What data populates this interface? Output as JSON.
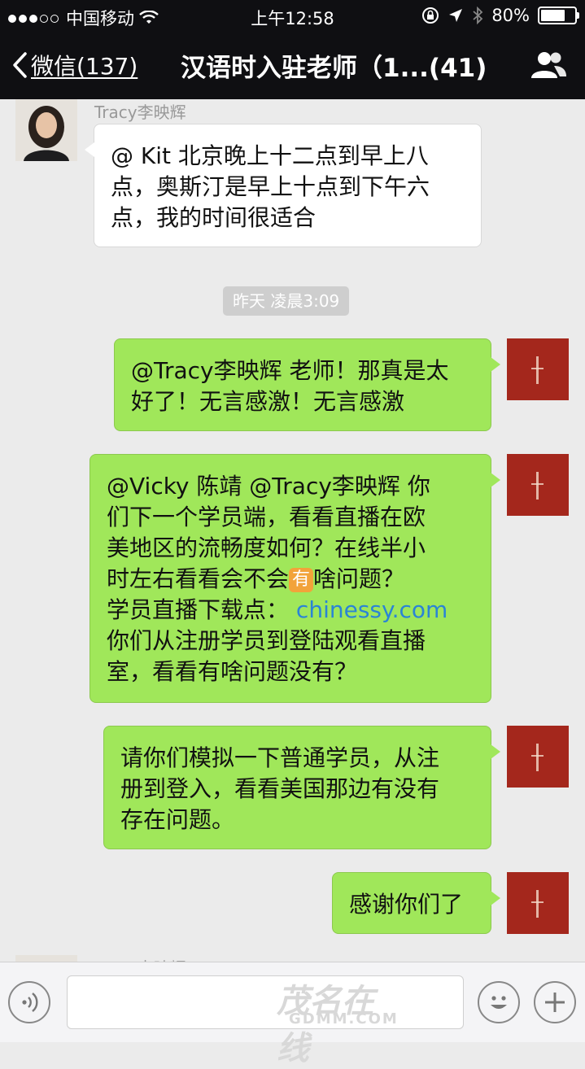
{
  "status_bar": {
    "carrier": "中国移动",
    "time": "上午12:58",
    "battery": "80%",
    "battery_level": 0.8
  },
  "nav": {
    "back_label": "微信(137)",
    "title": "汉语时入驻老师（1...(41)"
  },
  "messages": [
    {
      "sender": "Tracy李映辉",
      "direction": "in",
      "lines": [
        "@ Kit 北京晚上十二点到早上八",
        "点，奥斯汀是早上十点到下午六",
        "点，我的时间很适合"
      ]
    },
    {
      "direction": "out",
      "lines": [
        "@Tracy李映辉 老师！那真是太",
        "好了！无言感激！无言感激"
      ]
    },
    {
      "direction": "out",
      "lines_before": [
        "@Vicky 陈靖 @Tracy李映辉 你",
        "们下一个学员端，看看直播在欧",
        "美地区的流畅度如何？在线半小"
      ],
      "line4_start": "时左右看看会不会",
      "emoji": "有",
      "line4_end": "啥问题？",
      "line5_start": "学员直播下载点：",
      "link": "chinessy.com",
      "lines_after": [
        "你们从注册学员到登陆观看直播",
        "室，看看有啥问题没有？"
      ]
    },
    {
      "direction": "out",
      "lines": [
        "请你们模拟一下普通学员，从注",
        "册到登入，看看美国那边有没有",
        "存在问题。"
      ]
    },
    {
      "direction": "out",
      "lines": [
        "感谢你们了"
      ]
    },
    {
      "sender": "Tracy李映辉",
      "direction": "in"
    }
  ],
  "timestamp": "昨天  凌晨3:09",
  "watermark": {
    "brand": "茂名在线",
    "domain": "GDMM.COM"
  },
  "colors": {
    "bar_bg": "#0f0f12",
    "chat_bg": "#ebebeb",
    "out_bubble": "#a0e75a",
    "in_bubble": "#ffffff",
    "my_avatar": "#a4271c",
    "link": "#2a84d6"
  }
}
